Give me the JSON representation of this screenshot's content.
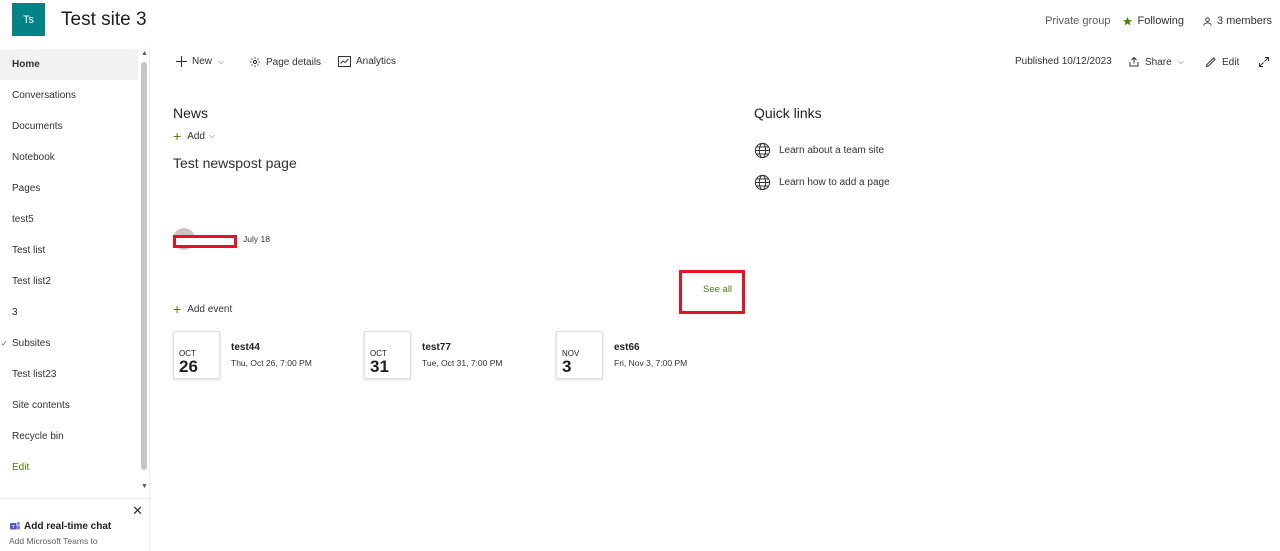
{
  "header": {
    "logo_text": "Ts",
    "site_title": "Test site 3",
    "privacy": "Private group",
    "following": "Following",
    "members": "3 members"
  },
  "nav": {
    "items": [
      "Home",
      "Conversations",
      "Documents",
      "Notebook",
      "Pages",
      "test5",
      "Test list",
      "Test list2",
      "3",
      "Subsites",
      "Test list23",
      "Site contents",
      "Recycle bin"
    ],
    "edit": "Edit"
  },
  "teams_prompt": {
    "title": "Add real-time chat",
    "desc": "Add Microsoft Teams to"
  },
  "commandbar": {
    "new": "New",
    "page_details": "Page details",
    "analytics": "Analytics",
    "published": "Published 10/12/2023",
    "share": "Share",
    "edit": "Edit"
  },
  "news": {
    "title": "News",
    "add": "Add",
    "post_title": "Test newspost page",
    "post_date": "July 18",
    "see_all": "See all"
  },
  "events": {
    "add": "Add event",
    "items": [
      {
        "month": "OCT",
        "day": "26",
        "title": "test44",
        "time": "Thu, Oct 26, 7:00 PM"
      },
      {
        "month": "OCT",
        "day": "31",
        "title": "test77",
        "time": "Tue, Oct 31, 7:00 PM"
      },
      {
        "month": "NOV",
        "day": "3",
        "title": "est66",
        "time": "Fri, Nov 3, 7:00 PM"
      }
    ]
  },
  "quick_links": {
    "title": "Quick links",
    "items": [
      "Learn about a team site",
      "Learn how to add a page"
    ]
  },
  "colors": {
    "brand": "#038387",
    "accent_green": "#498205",
    "highlight_red": "#e81123"
  }
}
